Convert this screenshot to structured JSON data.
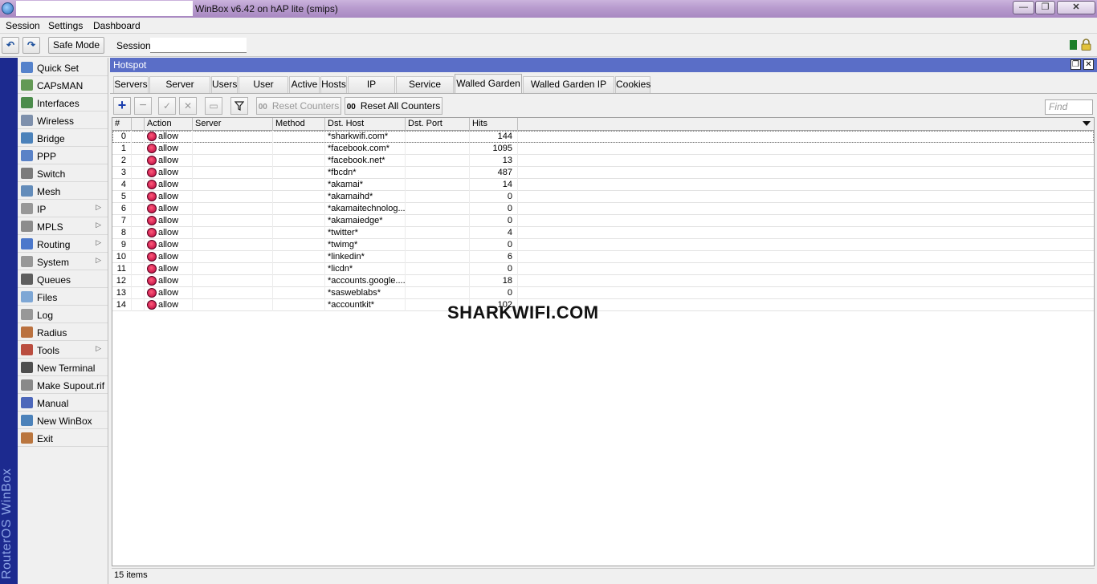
{
  "window": {
    "title": "WinBox v6.42 on hAP lite (smips)",
    "minimize": "—",
    "maximize": "❐",
    "close": "✕"
  },
  "menu": {
    "session": "Session",
    "settings": "Settings",
    "dashboard": "Dashboard"
  },
  "toolbar": {
    "undo": "↶",
    "redo": "↷",
    "safe_mode": "Safe Mode",
    "session_label": "Session:",
    "session_value": ""
  },
  "brand": "RouterOS WinBox",
  "sidebar": {
    "items": [
      {
        "label": "Quick Set",
        "icon": "quick-set-icon",
        "submenu": false
      },
      {
        "label": "CAPsMAN",
        "icon": "antenna-icon",
        "submenu": false
      },
      {
        "label": "Interfaces",
        "icon": "interfaces-icon",
        "submenu": false
      },
      {
        "label": "Wireless",
        "icon": "wireless-icon",
        "submenu": false
      },
      {
        "label": "Bridge",
        "icon": "bridge-icon",
        "submenu": false
      },
      {
        "label": "PPP",
        "icon": "ppp-icon",
        "submenu": false
      },
      {
        "label": "Switch",
        "icon": "switch-icon",
        "submenu": false
      },
      {
        "label": "Mesh",
        "icon": "mesh-icon",
        "submenu": false
      },
      {
        "label": "IP",
        "icon": "ip-icon",
        "submenu": true
      },
      {
        "label": "MPLS",
        "icon": "mpls-icon",
        "submenu": true
      },
      {
        "label": "Routing",
        "icon": "routing-icon",
        "submenu": true
      },
      {
        "label": "System",
        "icon": "system-icon",
        "submenu": true
      },
      {
        "label": "Queues",
        "icon": "queues-icon",
        "submenu": false
      },
      {
        "label": "Files",
        "icon": "files-icon",
        "submenu": false
      },
      {
        "label": "Log",
        "icon": "log-icon",
        "submenu": false
      },
      {
        "label": "Radius",
        "icon": "radius-icon",
        "submenu": false
      },
      {
        "label": "Tools",
        "icon": "tools-icon",
        "submenu": true
      },
      {
        "label": "New Terminal",
        "icon": "terminal-icon",
        "submenu": false
      },
      {
        "label": "Make Supout.rif",
        "icon": "supout-icon",
        "submenu": false
      },
      {
        "label": "Manual",
        "icon": "manual-icon",
        "submenu": false
      },
      {
        "label": "New WinBox",
        "icon": "winbox-icon",
        "submenu": false
      },
      {
        "label": "Exit",
        "icon": "exit-icon",
        "submenu": false
      }
    ],
    "submenu_arrow": "▷"
  },
  "hotspot": {
    "title": "Hotspot",
    "restore": "❐",
    "close": "✕",
    "tabs": [
      "Servers",
      "Server Profiles",
      "Users",
      "User Profiles",
      "Active",
      "Hosts",
      "IP Bindings",
      "Service Ports",
      "Walled Garden",
      "Walled Garden IP List",
      "Cookies"
    ],
    "active_tab": "Walled Garden",
    "actions": {
      "add": "+",
      "remove": "−",
      "enable": "✓",
      "disable": "✕",
      "comment": "▭",
      "filter": "⏷",
      "reset_counters": "Reset Counters",
      "reset_all_counters": "Reset All Counters",
      "counter_glyph": "00",
      "find_placeholder": "Find"
    },
    "columns": [
      "#",
      "Action",
      "Server",
      "Method",
      "Dst. Host",
      "Dst. Port",
      "Hits"
    ],
    "rows": [
      {
        "id": "0",
        "action": "allow",
        "server": "",
        "method": "",
        "dst_host": "*sharkwifi.com*",
        "dst_port": "",
        "hits": "144"
      },
      {
        "id": "1",
        "action": "allow",
        "server": "",
        "method": "",
        "dst_host": "*facebook.com*",
        "dst_port": "",
        "hits": "1095"
      },
      {
        "id": "2",
        "action": "allow",
        "server": "",
        "method": "",
        "dst_host": "*facebook.net*",
        "dst_port": "",
        "hits": "13"
      },
      {
        "id": "3",
        "action": "allow",
        "server": "",
        "method": "",
        "dst_host": "*fbcdn*",
        "dst_port": "",
        "hits": "487"
      },
      {
        "id": "4",
        "action": "allow",
        "server": "",
        "method": "",
        "dst_host": "*akamai*",
        "dst_port": "",
        "hits": "14"
      },
      {
        "id": "5",
        "action": "allow",
        "server": "",
        "method": "",
        "dst_host": "*akamaihd*",
        "dst_port": "",
        "hits": "0"
      },
      {
        "id": "6",
        "action": "allow",
        "server": "",
        "method": "",
        "dst_host": "*akamaitechnolog...",
        "dst_port": "",
        "hits": "0"
      },
      {
        "id": "7",
        "action": "allow",
        "server": "",
        "method": "",
        "dst_host": "*akamaiedge*",
        "dst_port": "",
        "hits": "0"
      },
      {
        "id": "8",
        "action": "allow",
        "server": "",
        "method": "",
        "dst_host": "*twitter*",
        "dst_port": "",
        "hits": "4"
      },
      {
        "id": "9",
        "action": "allow",
        "server": "",
        "method": "",
        "dst_host": "*twimg*",
        "dst_port": "",
        "hits": "0"
      },
      {
        "id": "10",
        "action": "allow",
        "server": "",
        "method": "",
        "dst_host": "*linkedin*",
        "dst_port": "",
        "hits": "6"
      },
      {
        "id": "11",
        "action": "allow",
        "server": "",
        "method": "",
        "dst_host": "*licdn*",
        "dst_port": "",
        "hits": "0"
      },
      {
        "id": "12",
        "action": "allow",
        "server": "",
        "method": "",
        "dst_host": "*accounts.google....",
        "dst_port": "",
        "hits": "18"
      },
      {
        "id": "13",
        "action": "allow",
        "server": "",
        "method": "",
        "dst_host": "*sasweblabs*",
        "dst_port": "",
        "hits": "0"
      },
      {
        "id": "14",
        "action": "allow",
        "server": "",
        "method": "",
        "dst_host": "*accountkit*",
        "dst_port": "",
        "hits": "102"
      }
    ],
    "status": "15 items"
  },
  "watermark": "SHARKWIFI.COM",
  "colors": {
    "titlebar": "#b89bce",
    "brand_strip": "#1c2a8f",
    "hotspot_header": "#5a6ec7",
    "allow_icon": "#d4003f"
  }
}
